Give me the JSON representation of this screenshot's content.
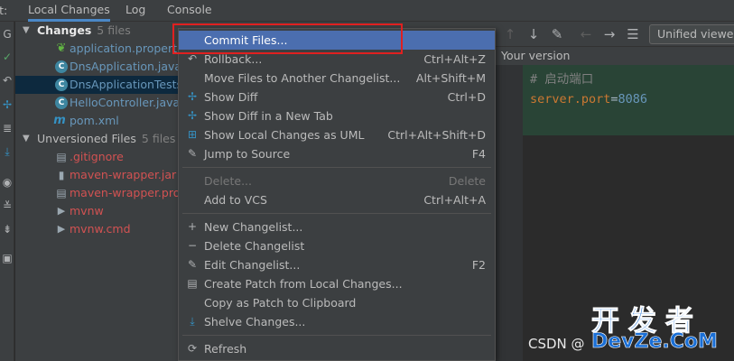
{
  "tabbar": {
    "prefix": "Git:",
    "tabs": [
      {
        "label": "Local Changes"
      },
      {
        "label": "Log"
      },
      {
        "label": "Console"
      }
    ]
  },
  "tree": {
    "changes": {
      "label": "Changes",
      "count": "5 files"
    },
    "files": [
      {
        "name": "application.properties",
        "icon": "leaf-icon",
        "color": "#6897bb"
      },
      {
        "name": "DnsApplication.java",
        "icon": "java-class-icon",
        "color": "#6897bb"
      },
      {
        "name": "DnsApplicationTests.java",
        "icon": "java-class-icon",
        "color": "#6897bb"
      },
      {
        "name": "HelloController.java",
        "icon": "java-class-icon",
        "color": "#6897bb"
      },
      {
        "name": "pom.xml",
        "icon": "maven-icon",
        "color": "#6897bb"
      }
    ],
    "unversioned": {
      "label": "Unversioned Files",
      "count": "5 files"
    },
    "unversioned_files": [
      {
        "name": ".gitignore",
        "icon": "file-icon",
        "color": "#d25252"
      },
      {
        "name": "maven-wrapper.jar",
        "icon": "jar-icon",
        "color": "#d25252"
      },
      {
        "name": "maven-wrapper.properties",
        "icon": "file-icon",
        "color": "#d25252"
      },
      {
        "name": "mvnw",
        "icon": "script-icon",
        "color": "#d25252"
      },
      {
        "name": "mvnw.cmd",
        "icon": "script-icon",
        "color": "#d25252"
      }
    ]
  },
  "menu": {
    "items": [
      {
        "label": "Commit Files...",
        "shortcut": "",
        "icon": "",
        "state": "hover"
      },
      {
        "label": "Rollback...",
        "shortcut": "Ctrl+Alt+Z",
        "icon": "rollback-icon"
      },
      {
        "label": "Move Files to Another Changelist...",
        "shortcut": "Alt+Shift+M",
        "icon": ""
      },
      {
        "label": "Show Diff",
        "shortcut": "Ctrl+D",
        "icon": "diff-icon"
      },
      {
        "label": "Show Diff in a New Tab",
        "shortcut": "",
        "icon": "diff-icon"
      },
      {
        "label": "Show Local Changes as UML",
        "shortcut": "Ctrl+Alt+Shift+D",
        "icon": "uml-icon"
      },
      {
        "label": "Jump to Source",
        "shortcut": "F4",
        "icon": "edit-icon"
      },
      {
        "label": "Delete...",
        "shortcut": "Delete",
        "icon": "",
        "state": "disabled"
      },
      {
        "label": "Add to VCS",
        "shortcut": "Ctrl+Alt+A",
        "icon": ""
      },
      {
        "label": "New Changelist...",
        "shortcut": "",
        "icon": "plus-icon"
      },
      {
        "label": "Delete Changelist",
        "shortcut": "",
        "icon": "minus-icon"
      },
      {
        "label": "Edit Changelist...",
        "shortcut": "F2",
        "icon": "pencil-icon"
      },
      {
        "label": "Create Patch from Local Changes...",
        "shortcut": "",
        "icon": "patch-icon"
      },
      {
        "label": "Copy as Patch to Clipboard",
        "shortcut": "",
        "icon": ""
      },
      {
        "label": "Shelve Changes...",
        "shortcut": "",
        "icon": "shelve-icon"
      },
      {
        "label": "Refresh",
        "shortcut": "",
        "icon": "refresh-icon"
      }
    ]
  },
  "diff": {
    "viewer": "Unified viewer",
    "version_label": "Your version",
    "comment": "# 启动端口",
    "key": "server.port",
    "eq": "=",
    "value": "8086"
  },
  "watermark": {
    "csdn": "CSDN @",
    "big": "开发者",
    "small": "DevZe.CoM"
  },
  "colors": {
    "accent": "#4b6eaf",
    "added_line_bg": "#294436",
    "highlight_border": "#e02020"
  }
}
